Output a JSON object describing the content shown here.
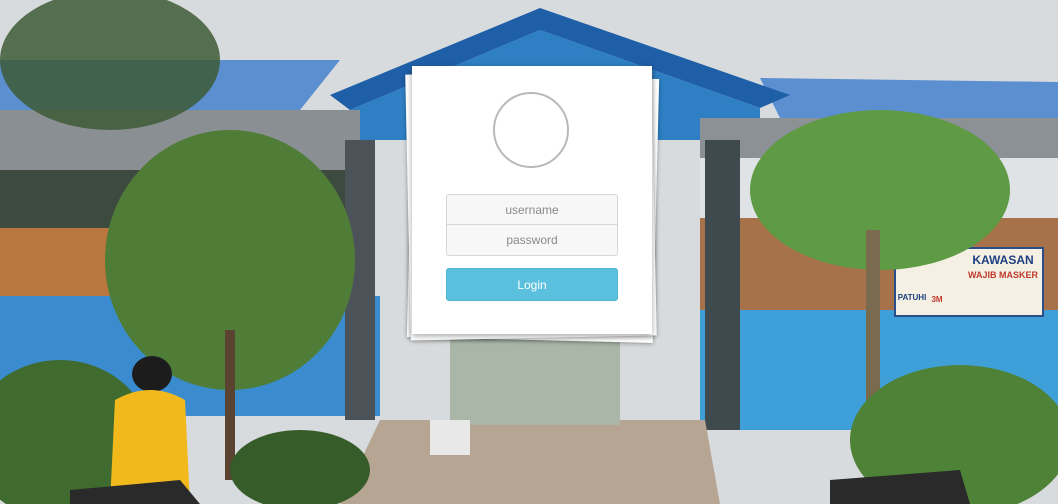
{
  "login": {
    "username_placeholder": "username",
    "password_placeholder": "password",
    "button_label": "Login"
  },
  "background": {
    "banner_line1": "KAWASAN",
    "banner_line2": "WAJIB MASKER",
    "banner_left": "PATUHI",
    "banner_mark": "3M"
  },
  "colors": {
    "button": "#5bc0de",
    "roof": "#2f6fb5",
    "wall": "#3a9fd8",
    "sky": "#dcdfe1"
  },
  "icons": {
    "avatar": "user-avatar-circle"
  }
}
